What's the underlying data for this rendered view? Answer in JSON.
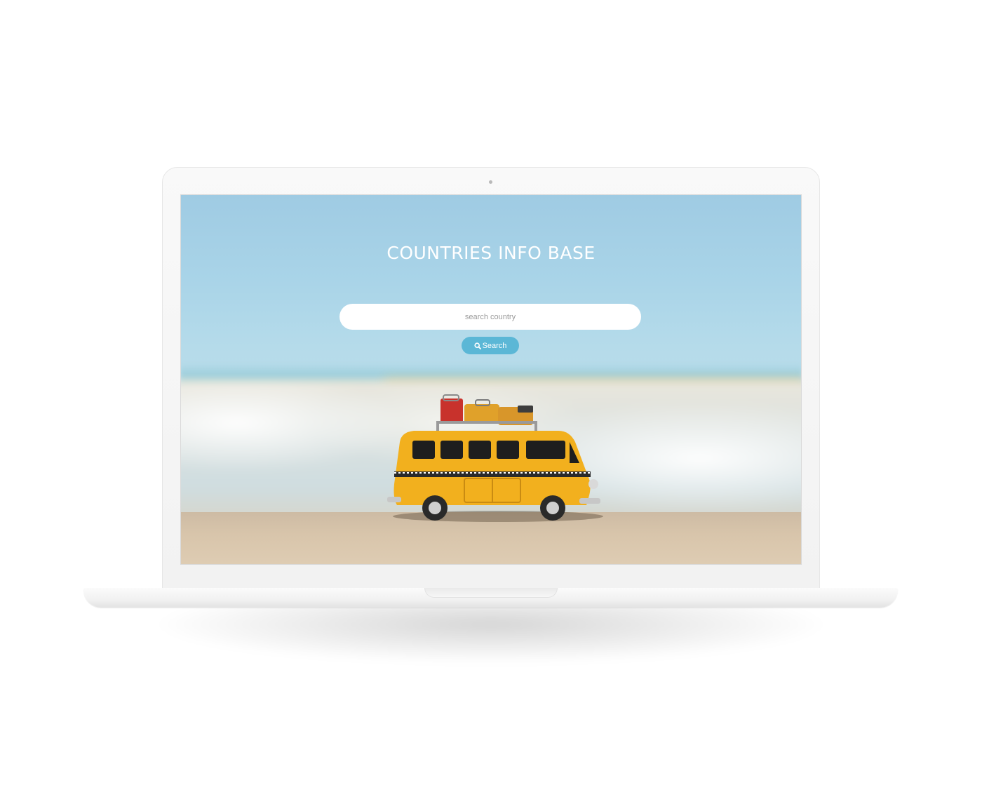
{
  "app": {
    "title": "COUNTRIES INFO BASE"
  },
  "search": {
    "placeholder": "search country",
    "value": "",
    "button_label": "Search",
    "button_icon": "search-icon"
  },
  "colors": {
    "accent": "#5bb7d6",
    "title_text": "#ffffff",
    "input_background": "#ffffff"
  }
}
